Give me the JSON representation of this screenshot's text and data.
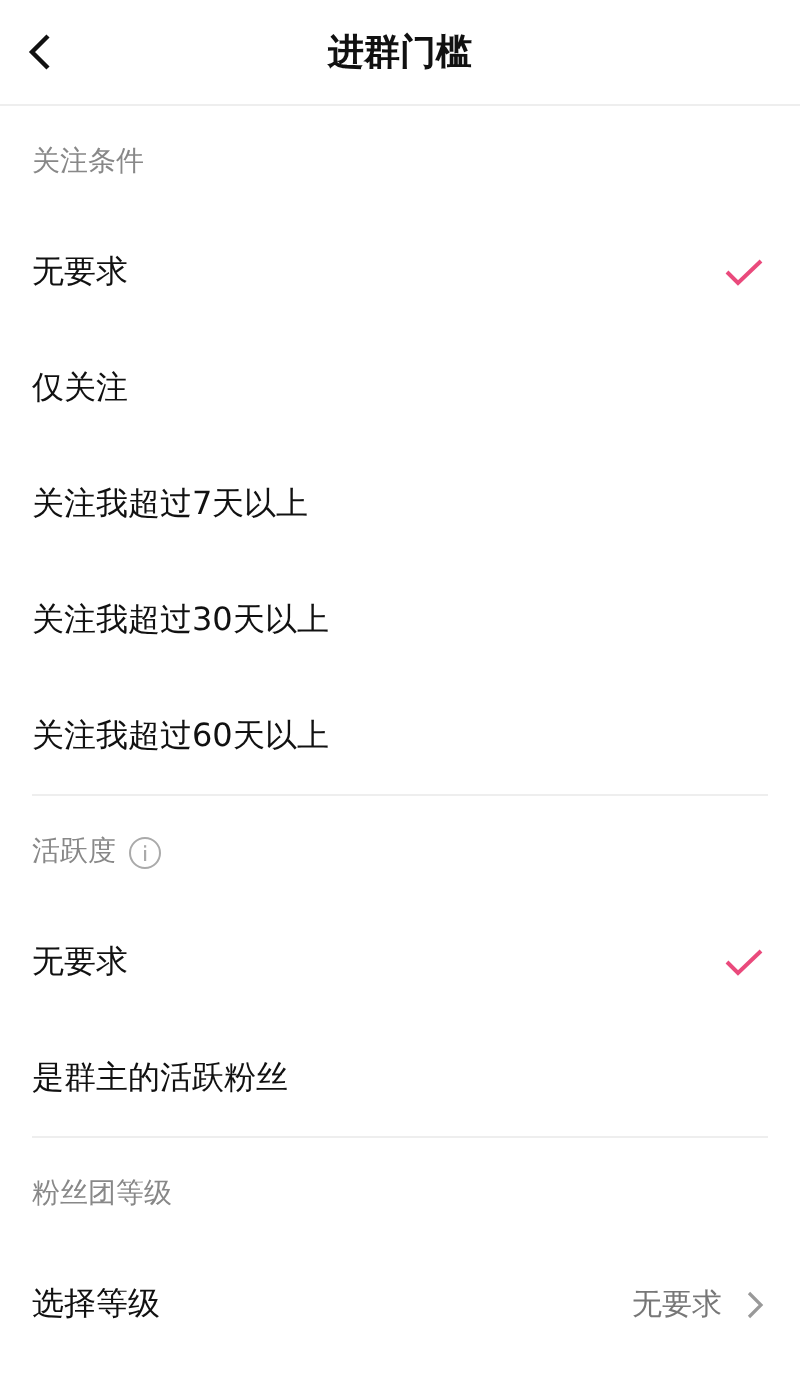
{
  "header": {
    "title": "进群门槛"
  },
  "sections": [
    {
      "title": "关注条件",
      "info": false,
      "rows": [
        {
          "kind": "option",
          "label": "无要求",
          "selected": true
        },
        {
          "kind": "option",
          "label": "仅关注",
          "selected": false
        },
        {
          "kind": "option",
          "label": "关注我超过7天以上",
          "selected": false
        },
        {
          "kind": "option",
          "label": "关注我超过30天以上",
          "selected": false
        },
        {
          "kind": "option",
          "label": "关注我超过60天以上",
          "selected": false
        }
      ]
    },
    {
      "title": "活跃度",
      "info": true,
      "rows": [
        {
          "kind": "option",
          "label": "无要求",
          "selected": true
        },
        {
          "kind": "option",
          "label": "是群主的活跃粉丝",
          "selected": false
        }
      ]
    },
    {
      "title": "粉丝团等级",
      "info": false,
      "rows": [
        {
          "kind": "select",
          "label": "选择等级",
          "value": "无要求"
        }
      ]
    }
  ]
}
